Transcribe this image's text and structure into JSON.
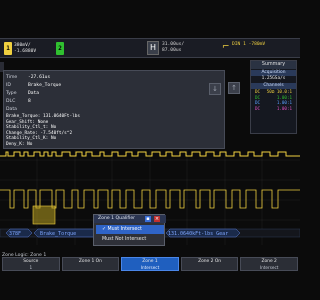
{
  "topbar": {
    "ch1": {
      "num": "1",
      "line1": "380mV/",
      "line2": "-1.6880V",
      "color": "#f0d040"
    },
    "ch2": {
      "num": "2",
      "line1": "",
      "line2": "",
      "color": "#30c030"
    },
    "run_symbol": "H",
    "timebase": {
      "line1": "31.00us/",
      "line2": "87.00us"
    },
    "trigger": {
      "line1": "DIN  1  -780mV",
      "line2": "",
      "color": "#f0d040"
    }
  },
  "listing": {
    "fields": [
      {
        "label": "Time",
        "value": "-27.61us"
      },
      {
        "label": "ID",
        "value": "Brake_Torque"
      },
      {
        "label": "Type",
        "value": "Data"
      },
      {
        "label": "DLC",
        "value": "8"
      },
      {
        "label": "Data",
        "value": ""
      }
    ],
    "details": [
      "Brake_Torque: 131.0640Ft-lbs",
      "Gear_Shift: None",
      "Stability_Ctl_t: No",
      "Change_Rate: -7.540ft/s^2",
      "Stability_Ctl_K: No",
      "Deny_K: No"
    ],
    "nav": {
      "down_icon": "arrow-down-icon",
      "up_icon": "arrow-up-icon"
    }
  },
  "summary": {
    "title": "Summary",
    "acq_label": "Acquisition",
    "sample_rate": "1.25GSa/s",
    "channels_label": "Channels",
    "rows": [
      {
        "label": "DC",
        "value": "50Ω 10.0:1",
        "color": "#f0d040"
      },
      {
        "label": "DC",
        "value": "1.00:1",
        "color": "#30c030"
      },
      {
        "label": "DC",
        "value": "1.00:1",
        "color": "#5aa0ff"
      },
      {
        "label": "DC",
        "value": "1.00:1",
        "color": "#e050c0"
      }
    ]
  },
  "waveform": {
    "decode_bar": [
      {
        "text": "378F"
      },
      {
        "text": "Brake_Torque"
      },
      {
        "text": "8"
      },
      {
        "text": "131.0640kFt-lbs Gear"
      }
    ]
  },
  "qualifier": {
    "title": "Zone 1 Qualifier",
    "options": [
      {
        "label": "Must Intersect",
        "selected": true
      },
      {
        "label": "Must Not Intersect",
        "selected": false
      }
    ]
  },
  "zone_label": "Zone Logic: Zone 1",
  "softkeys": [
    {
      "line1": "Source",
      "line2": "1",
      "active": false
    },
    {
      "line1": "Zone 1 On",
      "line2": "",
      "active": false
    },
    {
      "line1": "Zone 1",
      "line2": "Intersect",
      "active": true
    },
    {
      "line1": "Zone 2 On",
      "line2": "",
      "active": false
    },
    {
      "line1": "Zone 2",
      "line2": "Intersect",
      "active": false
    }
  ]
}
